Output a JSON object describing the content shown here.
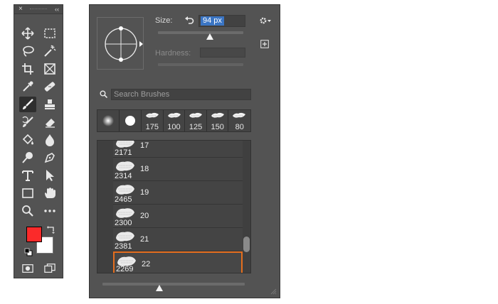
{
  "toolbar": {
    "close_glyph": "×",
    "collapse_glyph": "‹‹",
    "tools": [
      "move-icon",
      "marquee-icon",
      "lasso-icon",
      "magic-wand-icon",
      "crop-icon",
      "frame-icon",
      "eyedropper-icon",
      "healing-brush-icon",
      "brush-icon",
      "clone-stamp-icon",
      "history-brush-icon",
      "eraser-icon",
      "paint-bucket-icon",
      "blur-icon",
      "dodge-icon",
      "pen-icon",
      "type-icon",
      "path-selection-icon",
      "rectangle-icon",
      "hand-icon",
      "zoom-icon",
      "more-tools-icon"
    ],
    "selected_tool": "brush-icon",
    "foreground_color": "#fb2a2a",
    "background_color": "#ffffff"
  },
  "panel": {
    "size_label": "Size:",
    "size_value": "94 px",
    "size_fraction": 0.4,
    "hardness_label": "Hardness:",
    "search_placeholder": "Search Brushes",
    "recent_brushes": [
      {
        "kind": "soft",
        "label": ""
      },
      {
        "kind": "hard",
        "label": ""
      },
      {
        "kind": "texture",
        "label": "175"
      },
      {
        "kind": "texture",
        "label": "100"
      },
      {
        "kind": "texture",
        "label": "125"
      },
      {
        "kind": "texture",
        "label": "150"
      },
      {
        "kind": "texture",
        "label": "80"
      }
    ],
    "brushes": [
      {
        "size": "2171",
        "name": "17"
      },
      {
        "size": "2314",
        "name": "18"
      },
      {
        "size": "2465",
        "name": "19"
      },
      {
        "size": "2300",
        "name": "20"
      },
      {
        "size": "2381",
        "name": "21"
      },
      {
        "size": "2269",
        "name": "22"
      }
    ],
    "selected_brush": "22",
    "bottom_slider_fraction": 0.4,
    "colors": {
      "selection": "#e46e1e",
      "highlight": "#3a75c4"
    }
  }
}
